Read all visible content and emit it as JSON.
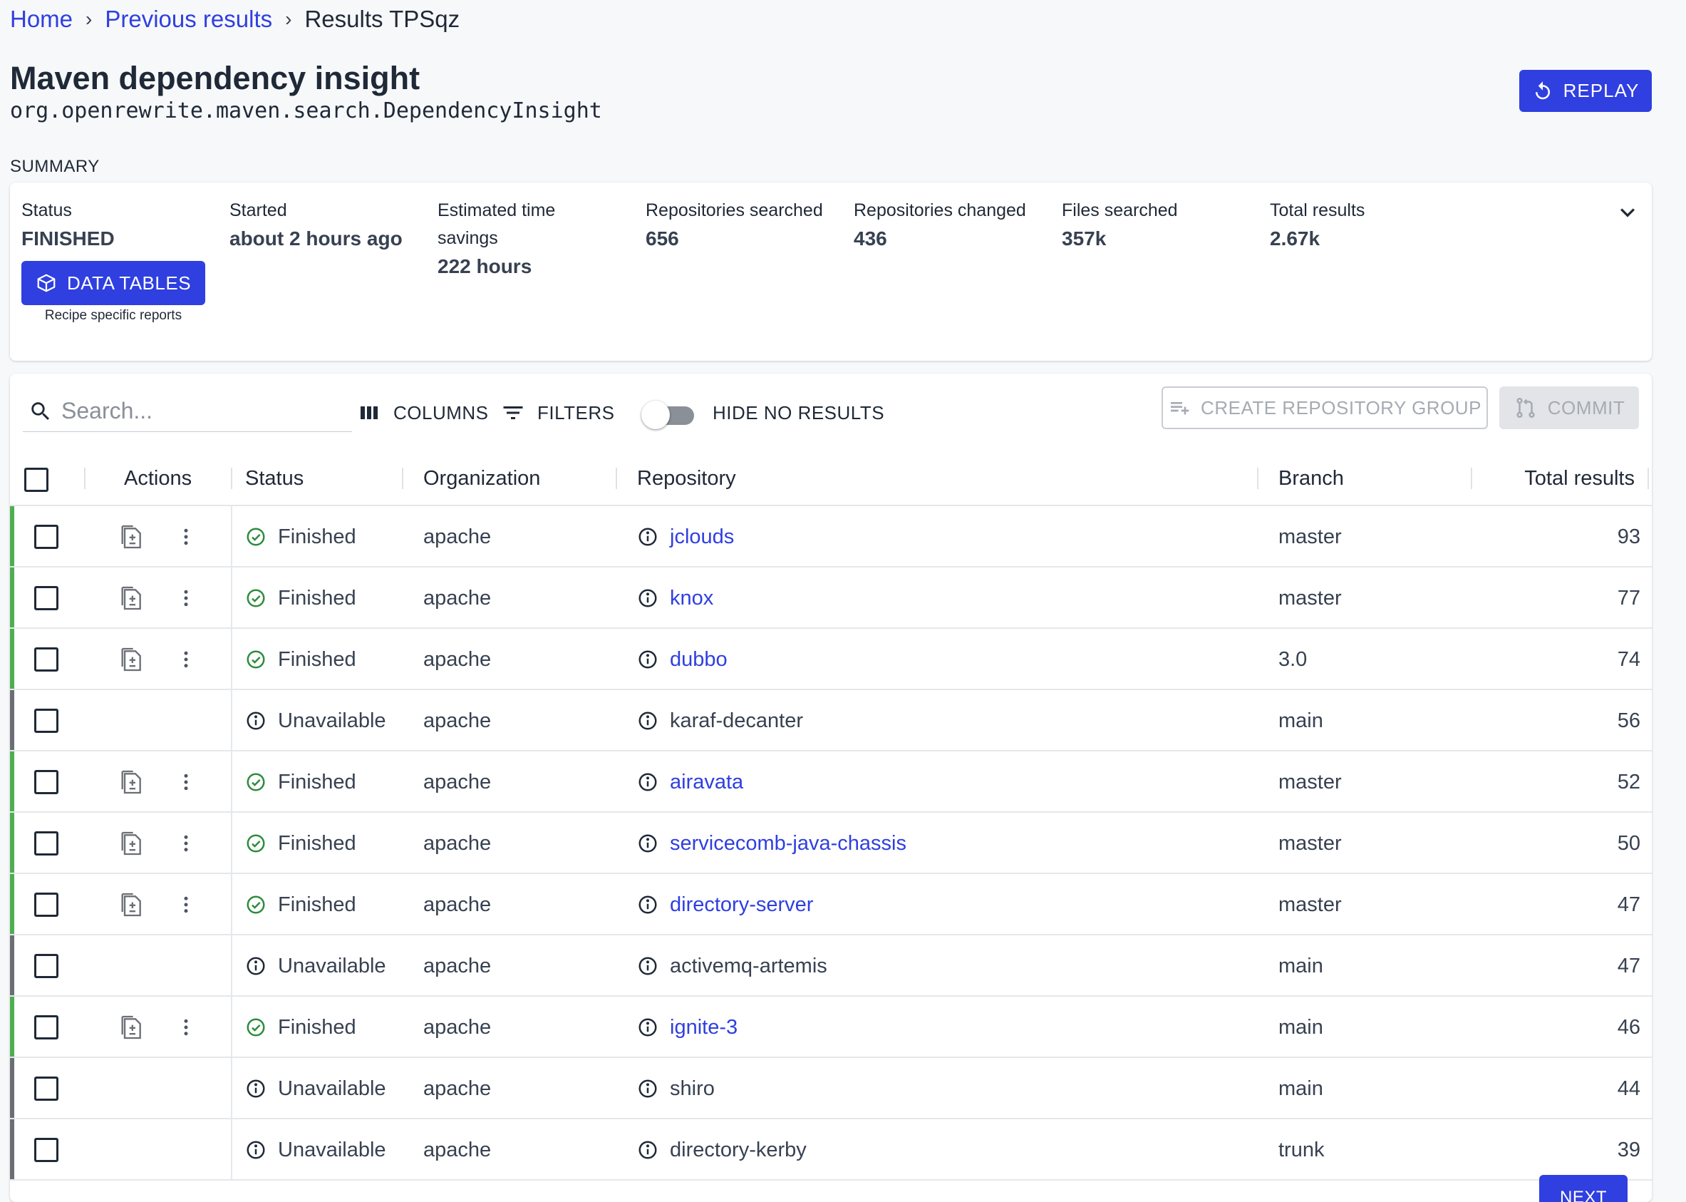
{
  "breadcrumb": {
    "home": "Home",
    "previous": "Previous results",
    "current": "Results TPSqz",
    "separator": "›"
  },
  "page": {
    "title": "Maven dependency insight",
    "subtitle": "org.openrewrite.maven.search.DependencyInsight",
    "replay_label": "REPLAY"
  },
  "summary": {
    "heading": "SUMMARY",
    "status_label": "Status",
    "status_value": "FINISHED",
    "started_label": "Started",
    "started_value": "about 2 hours ago",
    "savings_label_1": "Estimated time",
    "savings_label_2": "savings",
    "savings_value": "222 hours",
    "repos_searched_label": "Repositories searched",
    "repos_searched_value": "656",
    "repos_changed_label": "Repositories changed",
    "repos_changed_value": "436",
    "files_searched_label": "Files searched",
    "files_searched_value": "357k",
    "total_results_label": "Total results",
    "total_results_value": "2.67k",
    "data_tables_label": "DATA TABLES",
    "data_tables_caption": "Recipe specific reports"
  },
  "toolbar": {
    "search_placeholder": "Search...",
    "columns_label": "COLUMNS",
    "filters_label": "FILTERS",
    "hide_no_results_label": "HIDE NO RESULTS",
    "create_group_label": "CREATE REPOSITORY GROUP",
    "commit_label": "COMMIT"
  },
  "table": {
    "headers": {
      "actions": "Actions",
      "status": "Status",
      "organization": "Organization",
      "repository": "Repository",
      "branch": "Branch",
      "total": "Total results"
    },
    "rows": [
      {
        "status": "Finished",
        "org": "apache",
        "repo": "jclouds",
        "branch": "master",
        "total": "93"
      },
      {
        "status": "Finished",
        "org": "apache",
        "repo": "knox",
        "branch": "master",
        "total": "77"
      },
      {
        "status": "Finished",
        "org": "apache",
        "repo": "dubbo",
        "branch": "3.0",
        "total": "74"
      },
      {
        "status": "Unavailable",
        "org": "apache",
        "repo": "karaf-decanter",
        "branch": "main",
        "total": "56"
      },
      {
        "status": "Finished",
        "org": "apache",
        "repo": "airavata",
        "branch": "master",
        "total": "52"
      },
      {
        "status": "Finished",
        "org": "apache",
        "repo": "servicecomb-java-chassis",
        "branch": "master",
        "total": "50"
      },
      {
        "status": "Finished",
        "org": "apache",
        "repo": "directory-server",
        "branch": "master",
        "total": "47"
      },
      {
        "status": "Unavailable",
        "org": "apache",
        "repo": "activemq-artemis",
        "branch": "main",
        "total": "47"
      },
      {
        "status": "Finished",
        "org": "apache",
        "repo": "ignite-3",
        "branch": "main",
        "total": "46"
      },
      {
        "status": "Unavailable",
        "org": "apache",
        "repo": "shiro",
        "branch": "main",
        "total": "44"
      },
      {
        "status": "Unavailable",
        "org": "apache",
        "repo": "directory-kerby",
        "branch": "trunk",
        "total": "39"
      }
    ]
  },
  "pagination": {
    "next_label": "NEXT"
  },
  "colors": {
    "accent": "#2f3fe0",
    "finished": "#2e8b3d",
    "finished_bar": "#4caf50",
    "unavailable_bar": "#6b6e75"
  },
  "icons": {
    "replay": "replay-icon",
    "data_tables": "cube-icon",
    "search": "search-icon",
    "columns": "columns-icon",
    "filters": "filter-icon",
    "create_group": "playlist-add-icon",
    "commit": "pull-request-icon",
    "expand": "chevron-down-icon",
    "diff": "file-diff-icon",
    "more": "more-vert-icon",
    "finished": "check-circle-icon",
    "info": "info-icon"
  }
}
